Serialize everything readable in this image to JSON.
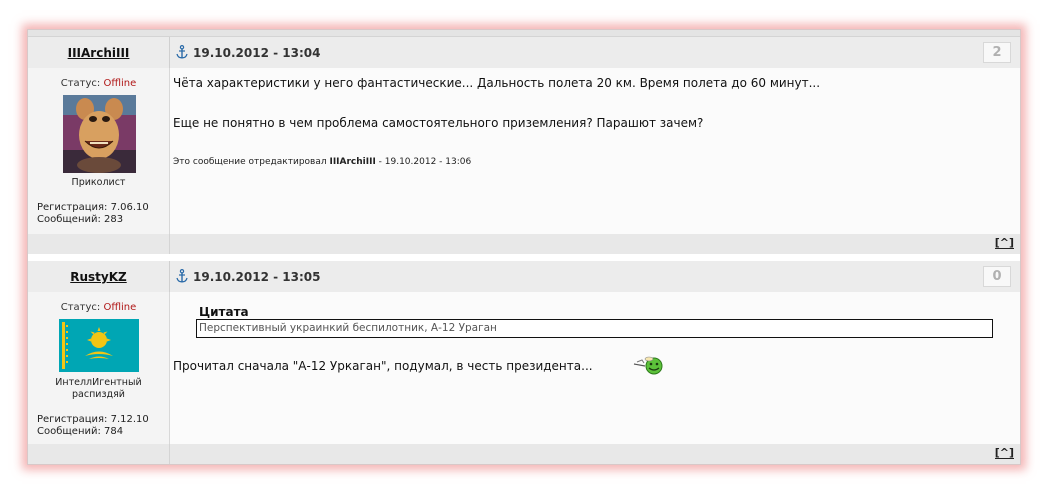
{
  "posts": [
    {
      "author": "IIIArchiIII",
      "status_label": "Статус: ",
      "status_value": "Offline",
      "rank": "Приколист",
      "registration": "Регистрация: 7.06.10",
      "messages": "Сообщений: 283",
      "date": "19.10.2012 - 13:04",
      "number": "2",
      "text_line1": "Чёта характеристики у него фантастические... Дальность полета 20 км. Время полета до 60 минут...",
      "text_line2": "Еще не понятно в чем проблема самостоятельного приземления? Парашют зачем?",
      "edit_prefix": "Это сообщение отредактировал ",
      "edit_author": "IIIArchiIII",
      "edit_suffix": " - 19.10.2012 - 13:06",
      "to_top": "[^]"
    },
    {
      "author": "RustyKZ",
      "status_label": "Статус: ",
      "status_value": "Offline",
      "rank_line1": "ИнтеллИгентный",
      "rank_line2": "распиздяй",
      "registration": "Регистрация: 7.12.10",
      "messages": "Сообщений: 784",
      "date": "19.10.2012 - 13:05",
      "number": "0",
      "quote_title": "Цитата",
      "quote_text": "Перспективный украинкий беспилотник, А-12 Ураган",
      "text": "Прочитал сначала \"А-12 Уркаган\", подумал, в честь президента...",
      "to_top": "[^]"
    }
  ],
  "icons": {
    "anchor": "anchor-icon",
    "avatar1": "jar-jar-avatar",
    "avatar2": "kazakhstan-flag-avatar",
    "smiley": "drinking-smiley-icon"
  },
  "colors": {
    "offline": "#b01818",
    "header_bg": "#ececec",
    "shadow": "#eb7878",
    "flag": "#00a6b4",
    "flag_sun": "#f2c515"
  }
}
